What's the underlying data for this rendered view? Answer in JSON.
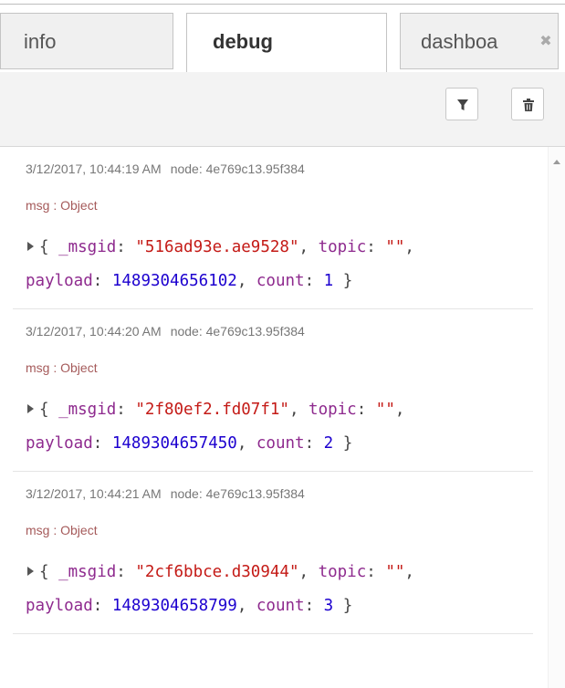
{
  "tabs": [
    {
      "label": "info",
      "active": false
    },
    {
      "label": "debug",
      "active": true
    },
    {
      "label": "dashboa",
      "active": false
    }
  ],
  "tab_close_glyph": "✖",
  "toolbar": {
    "filter_icon": "filter-icon",
    "clear_icon": "trash-icon"
  },
  "messages": [
    {
      "timestamp": "3/12/2017, 10:44:19 AM",
      "node": "node: 4e769c13.95f384",
      "type": "msg : Object",
      "msgid_key": "_msgid",
      "msgid": "\"516ad93e.ae9528\"",
      "topic_key": "topic",
      "topic": "\"\"",
      "payload_key": "payload",
      "payload": "1489304656102",
      "count_key": "count",
      "count": "1"
    },
    {
      "timestamp": "3/12/2017, 10:44:20 AM",
      "node": "node: 4e769c13.95f384",
      "type": "msg : Object",
      "msgid_key": "_msgid",
      "msgid": "\"2f80ef2.fd07f1\"",
      "topic_key": "topic",
      "topic": "\"\"",
      "payload_key": "payload",
      "payload": "1489304657450",
      "count_key": "count",
      "count": "2"
    },
    {
      "timestamp": "3/12/2017, 10:44:21 AM",
      "node": "node: 4e769c13.95f384",
      "type": "msg : Object",
      "msgid_key": "_msgid",
      "msgid": "\"2cf6bbce.d30944\"",
      "topic_key": "topic",
      "topic": "\"\"",
      "payload_key": "payload",
      "payload": "1489304658799",
      "count_key": "count",
      "count": "3"
    }
  ],
  "colors": {
    "key": "#8e2a8e",
    "string": "#c41a16",
    "number": "#1c00cf",
    "type_label": "#a55a5a"
  }
}
